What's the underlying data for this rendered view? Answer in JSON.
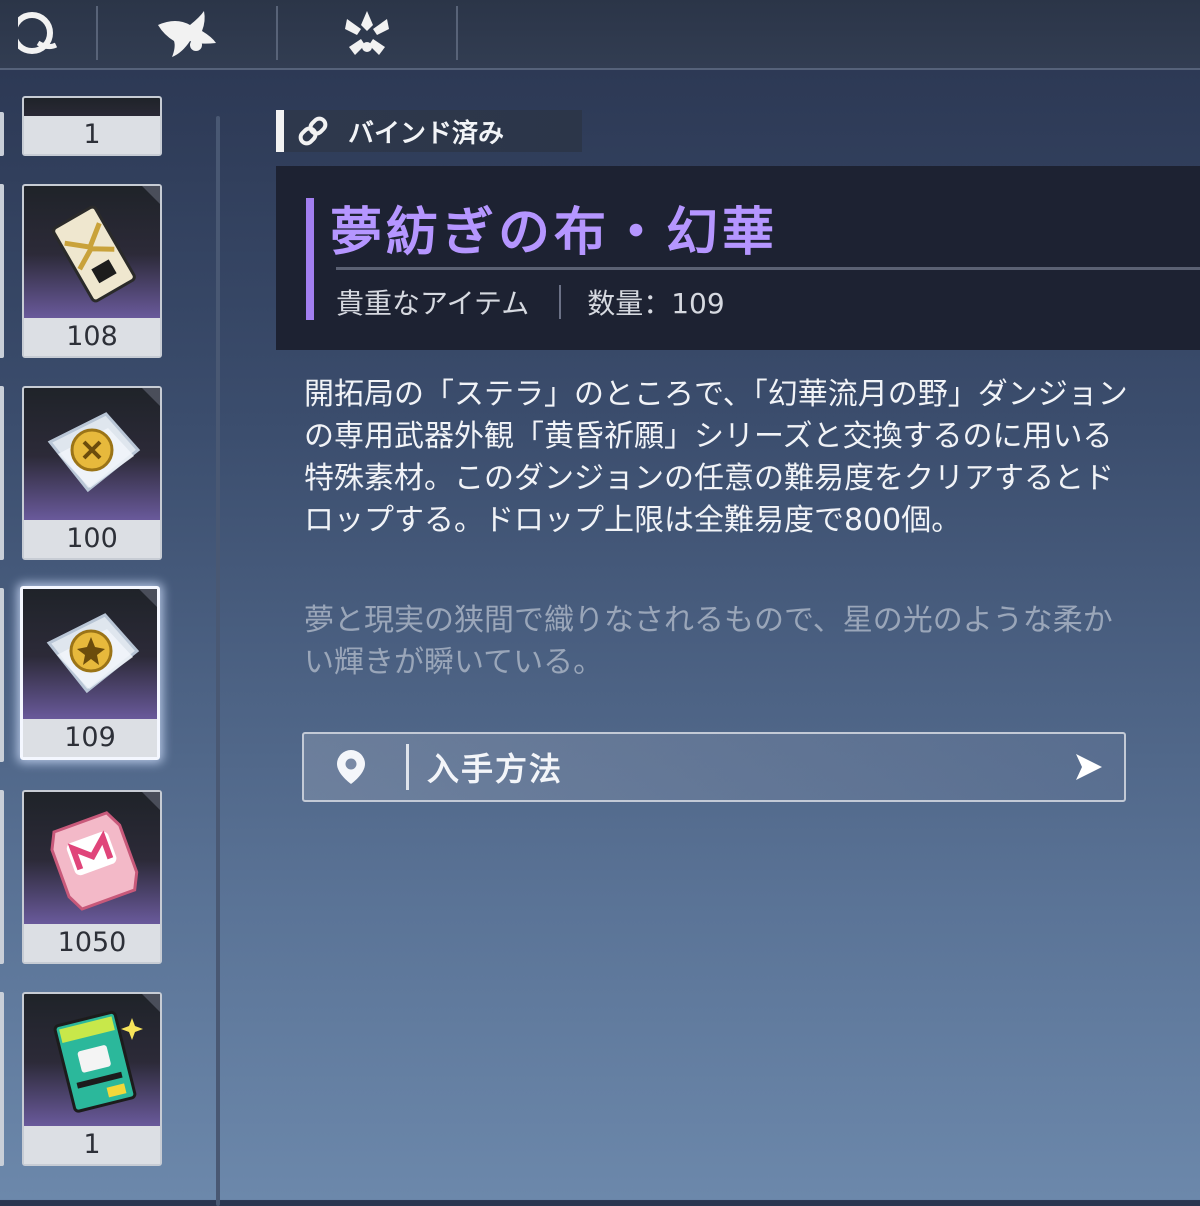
{
  "tabs": [
    {
      "icon": "potion-icon"
    },
    {
      "icon": "fish-icon"
    },
    {
      "icon": "sparkle-icon"
    }
  ],
  "items": [
    {
      "count": "1",
      "art": "top-partial-icon"
    },
    {
      "count": "108",
      "art": "gold-ticket-icon"
    },
    {
      "count": "100",
      "art": "silver-cloth-icon"
    },
    {
      "count": "109",
      "art": "silver-cloth-icon",
      "selected": true
    },
    {
      "count": "1050",
      "art": "pink-coupon-icon"
    },
    {
      "count": "1",
      "art": "green-card-icon"
    }
  ],
  "detail": {
    "bind_status": "バインド済み",
    "name": "夢紡ぎの布・幻華",
    "category": "貴重なアイテム",
    "quantity_label": "数量：109",
    "description": "開拓局の「ステラ」のところで、「幻華流月の野」ダンジョンの専用武器外観「黄昏祈願」シリーズと交換するのに用いる特殊素材。このダンジョンの任意の難易度をクリアするとドロップする。ドロップ上限は全難易度で800個。",
    "flavor": "夢と現実の狭間で織りなされるもので、星の光のような柔かい輝きが瞬いている。",
    "acquire_label": "入手方法"
  },
  "colors": {
    "title": "#b596ff",
    "accent": "#a27ff0",
    "panel": "#1d2232"
  }
}
